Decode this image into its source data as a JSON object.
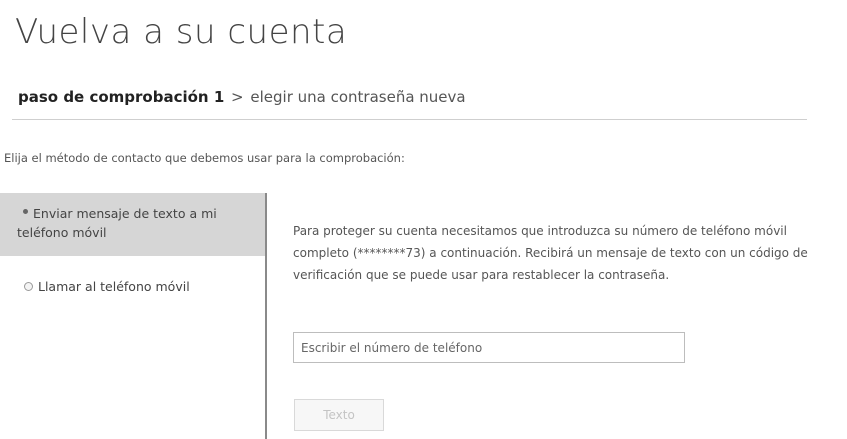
{
  "page": {
    "title": "Vuelva a su cuenta"
  },
  "breadcrumb": {
    "current_step": "paso de comprobación 1",
    "separator": ">",
    "next_step": "elegir una contraseña nueva"
  },
  "instruction": "Elija el método de contacto que debemos usar para la comprobación:",
  "contact_methods": {
    "options": [
      {
        "label": "Enviar mensaje de texto a mi teléfono móvil",
        "selected": true
      },
      {
        "label": "Llamar al teléfono móvil",
        "selected": false
      }
    ]
  },
  "panel": {
    "description": "Para proteger su cuenta necesitamos que introduzca su número de teléfono móvil completo (********73) a continuación. Recibirá un mensaje de texto con un código de verificación que se puede usar para restablecer la contraseña.",
    "phone_input": {
      "placeholder": "Escribir el número de teléfono",
      "value": ""
    },
    "submit_label": "Texto",
    "submit_enabled": false
  },
  "colors": {
    "selected_option_bg": "#d6d6d6",
    "divider": "#cfcfcf",
    "disabled_button_text": "#c4c4c4"
  }
}
